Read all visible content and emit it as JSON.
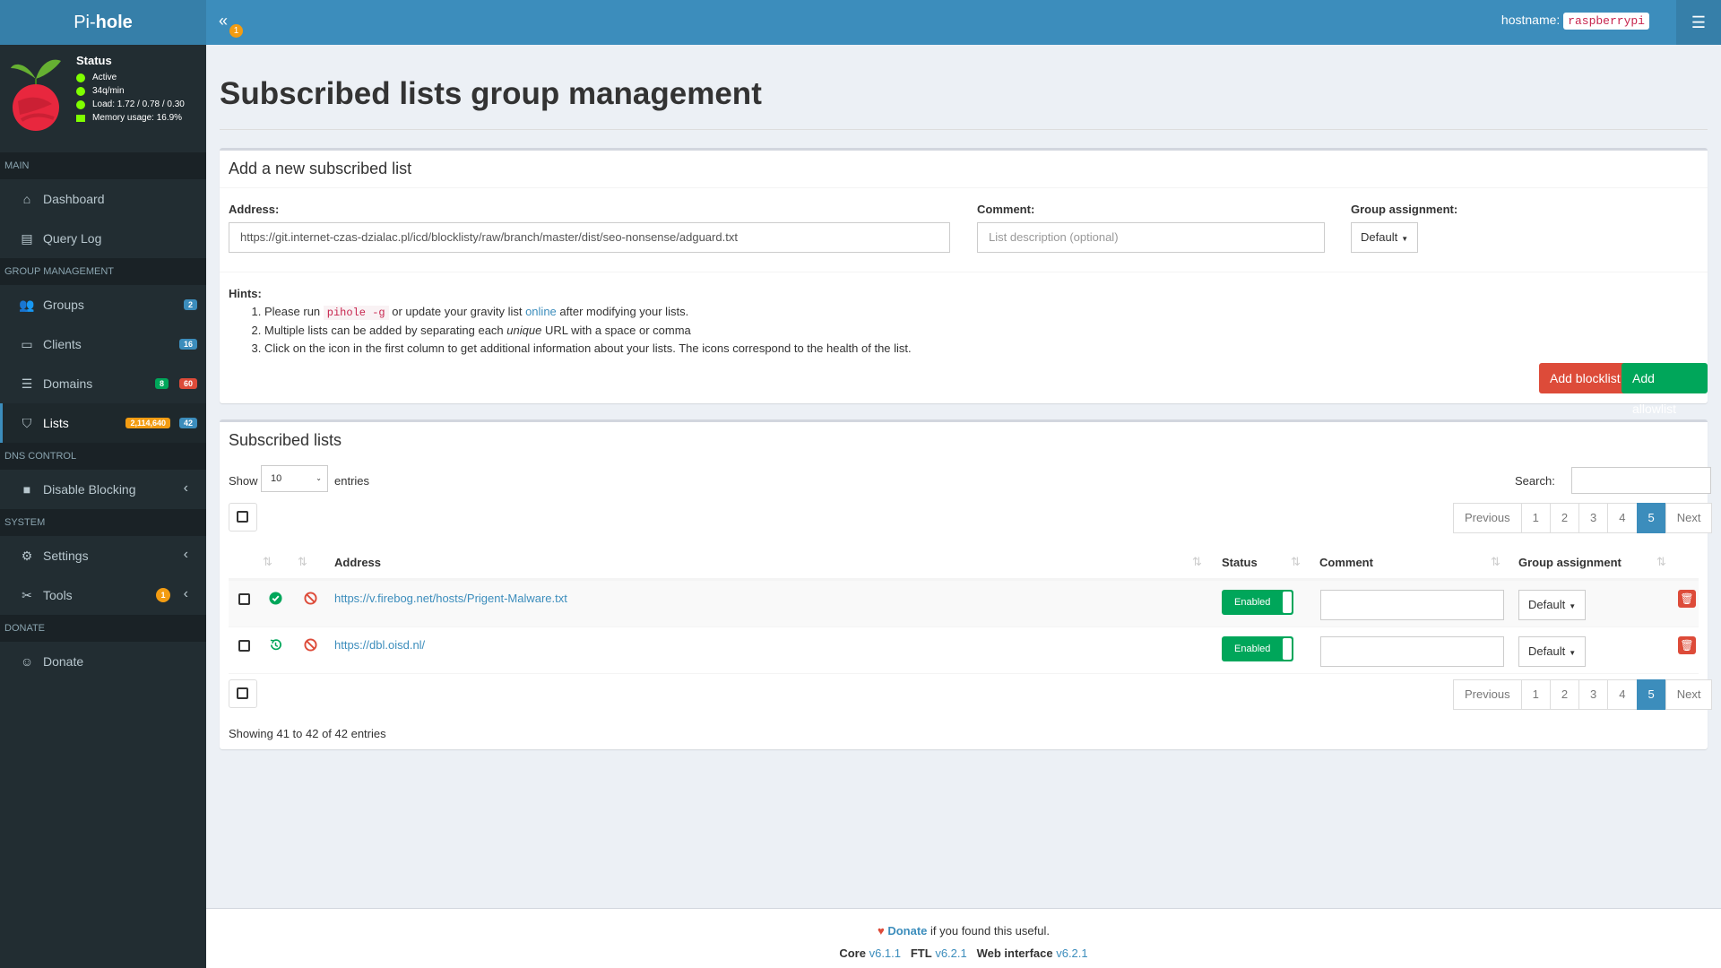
{
  "header": {
    "logo_pre": "Pi-",
    "logo_bold": "hole",
    "toggle_badge": "1",
    "hostname_label": "hostname:",
    "hostname_value": "raspberrypi"
  },
  "status": {
    "title": "Status",
    "state": "Active",
    "rate": "34q/min",
    "load": "Load: 1.72 / 0.78 / 0.30",
    "memory": "Memory usage: 16.9%"
  },
  "sidebar": {
    "sections": [
      "MAIN",
      "GROUP MANAGEMENT",
      "DNS CONTROL",
      "SYSTEM",
      "DONATE"
    ],
    "items": [
      {
        "label": "Dashboard"
      },
      {
        "label": "Query Log"
      },
      {
        "label": "Groups",
        "badge": "2"
      },
      {
        "label": "Clients",
        "badge": "16"
      },
      {
        "label": "Domains",
        "badge_a": "8",
        "badge_b": "60"
      },
      {
        "label": "Lists",
        "badge_a": "2,114,640",
        "badge_b": "42"
      },
      {
        "label": "Disable Blocking"
      },
      {
        "label": "Settings"
      },
      {
        "label": "Tools",
        "badge": "1"
      },
      {
        "label": "Donate"
      }
    ]
  },
  "page": {
    "title": "Subscribed lists group management"
  },
  "add_box": {
    "title": "Add a new subscribed list",
    "address_label": "Address:",
    "address_value": "https://git.internet-czas-dzialac.pl/icd/blocklisty/raw/branch/master/dist/seo-nonsense/adguard.txt",
    "comment_label": "Comment:",
    "comment_placeholder": "List description (optional)",
    "group_label": "Group assignment:",
    "group_value": "Default",
    "hints_title": "Hints:",
    "hint1_pre": "Please run",
    "hint1_code": "pihole -g",
    "hint1_mid": "or update your gravity list",
    "hint1_link": "online",
    "hint1_post": "after modifying your lists.",
    "hint2_pre": "Multiple lists can be added by separating each",
    "hint2_em": "unique",
    "hint2_post": "URL with a space or comma",
    "hint3": "Click on the icon in the first column to get additional information about your lists. The icons correspond to the health of the list.",
    "btn_block": "Add blocklist",
    "btn_allow": "Add allowlist"
  },
  "lists_box": {
    "title": "Subscribed lists",
    "show_label": "Show",
    "show_value": "10",
    "entries_label": "entries",
    "search_label": "Search:",
    "pager": [
      "Previous",
      "1",
      "2",
      "3",
      "4",
      "5",
      "Next"
    ],
    "pager_active": "5",
    "columns": {
      "address": "Address",
      "status": "Status",
      "comment": "Comment",
      "group": "Group assignment"
    },
    "rows": [
      {
        "address": "https://v.firebog.net/hosts/Prigent-Malware.txt",
        "status": "Enabled",
        "group": "Default",
        "health": "ok"
      },
      {
        "address": "https://dbl.oisd.nl/",
        "status": "Enabled",
        "group": "Default",
        "health": "pending"
      }
    ],
    "showing": "Showing 41 to 42 of 42 entries"
  },
  "footer": {
    "donate_link": "Donate",
    "donate_text": "if you found this useful.",
    "core_label": "Core",
    "core_ver": "v6.1.1",
    "ftl_label": "FTL",
    "ftl_ver": "v6.2.1",
    "web_label": "Web interface",
    "web_ver": "v6.2.1"
  }
}
